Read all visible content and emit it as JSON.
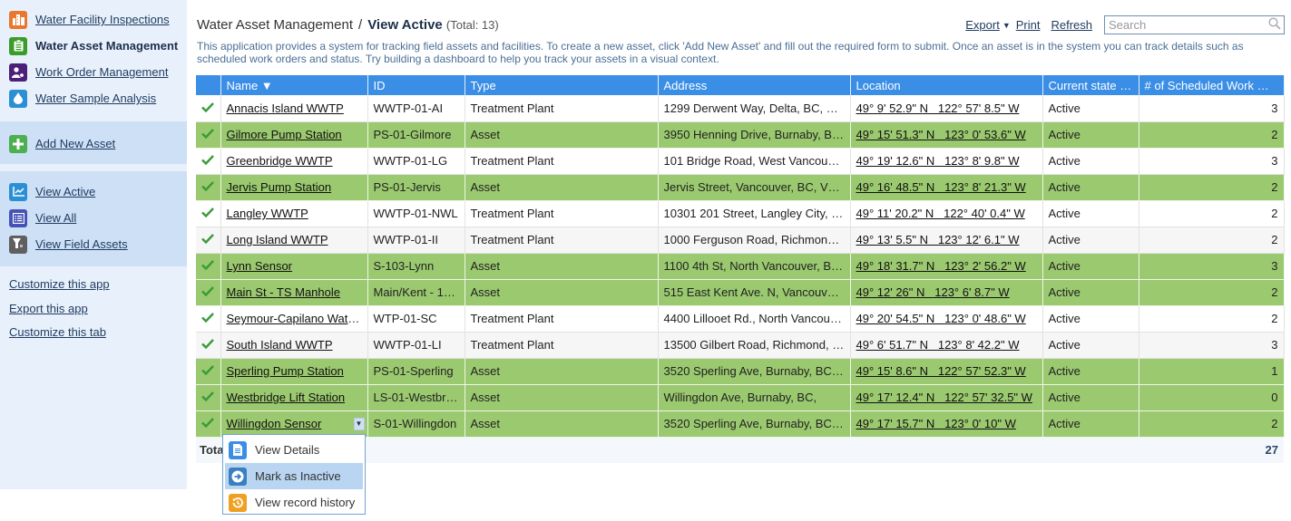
{
  "sidebar": {
    "apps": [
      {
        "label": "Water Facility Inspections",
        "icon": "building-icon",
        "color": "#e8782f",
        "current": false
      },
      {
        "label": "Water Asset Management",
        "icon": "clipboard-icon",
        "color": "#3c9c2a",
        "current": true
      },
      {
        "label": "Work Order Management",
        "icon": "user-gear-icon",
        "color": "#4b1f7a",
        "current": false
      },
      {
        "label": "Water Sample Analysis",
        "icon": "water-drop-icon",
        "color": "#2b8fd6",
        "current": false
      }
    ],
    "add_label": "Add New Asset",
    "add_color": "#4caf50",
    "views": [
      {
        "label": "View Active",
        "icon": "line-chart-icon",
        "color": "#2b8fd6"
      },
      {
        "label": "View All",
        "icon": "list-icon",
        "color": "#4652b8"
      },
      {
        "label": "View Field Assets",
        "icon": "funnel-device-icon",
        "color": "#5f5f5f"
      }
    ],
    "links": [
      "Customize this app",
      "Export this app",
      "Customize this tab"
    ]
  },
  "header": {
    "app_name": "Water Asset Management",
    "separator": "/",
    "view_name": "View Active",
    "total": "(Total: 13)",
    "export_label": "Export",
    "print_label": "Print",
    "refresh_label": "Refresh",
    "search_placeholder": "Search",
    "search_value": ""
  },
  "description": "This application provides a system for tracking field assets and facilities. To create a new asset, click 'Add New Asset' and fill out the required form to submit. Once an asset is in the system you can track details such as scheduled work orders and status. Try building a dashboard to help you track your assets in a visual context.",
  "table": {
    "columns": [
      "",
      "Name ▼",
      "ID",
      "Type",
      "Address",
      "Location",
      "Current state n…",
      "# of Scheduled Work Or…"
    ],
    "rows": [
      {
        "name": "Annacis Island WWTP",
        "id": "WWTP-01-AI",
        "type": "Treatment Plant",
        "address": "1299 Derwent Way, Delta, BC, V3…",
        "location": "49° 9' 52.9\" N   122° 57' 8.5\" W",
        "state": "Active",
        "count": "3",
        "style": "white"
      },
      {
        "name": "Gilmore Pump Station",
        "id": "PS-01-Gilmore",
        "type": "Asset",
        "address": "3950 Henning Drive, Burnaby, BC,…",
        "location": "49° 15' 51.3\" N   123° 0' 53.6\" W",
        "state": "Active",
        "count": "2",
        "style": "green"
      },
      {
        "name": "Greenbridge WWTP",
        "id": "WWTP-01-LG",
        "type": "Treatment Plant",
        "address": "101 Bridge Road, West Vancouver…",
        "location": "49° 19' 12.6\" N   123° 8' 9.8\" W",
        "state": "Active",
        "count": "3",
        "style": "white"
      },
      {
        "name": "Jervis Pump Station",
        "id": "PS-01-Jervis",
        "type": "Asset",
        "address": "Jervis Street, Vancouver, BC, V6E…",
        "location": "49° 16' 48.5\" N   123° 8' 21.3\" W",
        "state": "Active",
        "count": "2",
        "style": "green"
      },
      {
        "name": "Langley WWTP",
        "id": "WWTP-01-NWL",
        "type": "Treatment Plant",
        "address": "10301 201 Street, Langley City, B…",
        "location": "49° 11' 20.2\" N   122° 40' 0.4\" W",
        "state": "Active",
        "count": "2",
        "style": "white"
      },
      {
        "name": "Long Island WWTP",
        "id": "WWTP-01-II",
        "type": "Treatment Plant",
        "address": "1000 Ferguson Road, Richmond, …",
        "location": "49° 13' 5.5\" N   123° 12' 6.1\" W",
        "state": "Active",
        "count": "2",
        "style": "alt"
      },
      {
        "name": "Lynn Sensor",
        "id": "S-103-Lynn",
        "type": "Asset",
        "address": "1100 4th St, North Vancouver, BC,…",
        "location": "49° 18' 31.7\" N   123° 2' 56.2\" W",
        "state": "Active",
        "count": "3",
        "style": "green"
      },
      {
        "name": "Main St - TS Manhole",
        "id": "Main/Kent - 10…",
        "type": "Asset",
        "address": "515 East Kent Ave. N, Vancouver, …",
        "location": "49° 12' 26\" N   123° 6' 8.7\" W",
        "state": "Active",
        "count": "2",
        "style": "green"
      },
      {
        "name": "Seymour-Capilano Water…",
        "id": "WTP-01-SC",
        "type": "Treatment Plant",
        "address": "4400 Lillooet Rd., North Vancouve…",
        "location": "49° 20' 54.5\" N   123° 0' 48.6\" W",
        "state": "Active",
        "count": "2",
        "style": "white"
      },
      {
        "name": "South Island WWTP",
        "id": "WWTP-01-LI",
        "type": "Treatment Plant",
        "address": "13500 Gilbert Road, Richmond, B…",
        "location": "49° 6' 51.7\" N   123° 8' 42.2\" W",
        "state": "Active",
        "count": "3",
        "style": "alt"
      },
      {
        "name": "Sperling Pump Station",
        "id": "PS-01-Sperling",
        "type": "Asset",
        "address": "3520 Sperling Ave, Burnaby, BC, …",
        "location": "49° 15' 8.6\" N   122° 57' 52.3\" W",
        "state": "Active",
        "count": "1",
        "style": "green"
      },
      {
        "name": "Westbridge Lift Station",
        "id": "LS-01-Westbrid…",
        "type": "Asset",
        "address": "Willingdon Ave, Burnaby, BC,",
        "location": "49° 17' 12.4\" N   122° 57' 32.5\" W",
        "state": "Active",
        "count": "0",
        "style": "green"
      },
      {
        "name": "Willingdon Sensor",
        "id": "S-01-Willingdon",
        "type": "Asset",
        "address": "3520 Sperling Ave, Burnaby, BC, …",
        "location": "49° 17' 15.7\" N   123° 0' 10\" W",
        "state": "Active",
        "count": "2",
        "style": "green",
        "dropdown_open": true
      }
    ],
    "total_label": "Total",
    "total_value": "27",
    "check_color": "#3a9a3a",
    "green_row_color": "#9bc96f",
    "header_color": "#3a8ee6"
  },
  "row_menu": {
    "items": [
      {
        "label": "View Details",
        "icon": "document-icon",
        "color": "#3a8ee6",
        "highlighted": false
      },
      {
        "label": "Mark as Inactive",
        "icon": "arrow-right-circle-icon",
        "color": "#3a7fc0",
        "highlighted": true
      },
      {
        "label": "View record history",
        "icon": "history-icon",
        "color": "#f0a020",
        "highlighted": false
      }
    ]
  }
}
